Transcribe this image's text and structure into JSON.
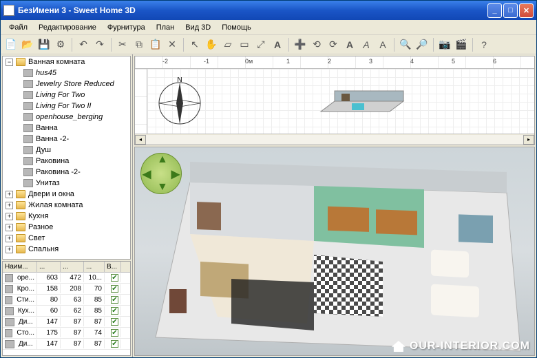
{
  "window": {
    "title": "БезИмени 3 - Sweet Home 3D"
  },
  "menu": [
    "Файл",
    "Редактирование",
    "Фурнитура",
    "План",
    "Вид 3D",
    "Помощь"
  ],
  "toolbar_icons": [
    "new-file",
    "open",
    "save",
    "preferences",
    "undo",
    "redo",
    "cut",
    "copy",
    "paste",
    "delete",
    "select",
    "pan",
    "walls",
    "room",
    "dimension",
    "text",
    "compass",
    "rotate-left",
    "rotate-right",
    "text-bold",
    "text-italic",
    "zoom-in",
    "zoom-out",
    "camera",
    "snapshot",
    "help"
  ],
  "tree": {
    "root": "Ванная комната",
    "children_italic": [
      "hus45",
      "Jewelry Store Reduced",
      "Living For Two",
      "Living For Two II",
      "openhouse_berging"
    ],
    "children_plain": [
      "Ванна",
      "Ванна -2-",
      "Душ",
      "Раковина",
      "Раковина -2-",
      "Унитаз"
    ],
    "siblings": [
      "Двери и окна",
      "Жилая комната",
      "Кухня",
      "Разное",
      "Свет",
      "Спальня"
    ]
  },
  "table": {
    "headers": [
      "Наим...",
      "...",
      "...",
      "...",
      "В..."
    ],
    "rows": [
      {
        "name": "оре...",
        "w": "603",
        "d": "472",
        "h": "10...",
        "v": true
      },
      {
        "name": "Кро...",
        "w": "158",
        "d": "208",
        "h": "70",
        "v": true
      },
      {
        "name": "Сти...",
        "w": "80",
        "d": "63",
        "h": "85",
        "v": true
      },
      {
        "name": "Кух...",
        "w": "60",
        "d": "62",
        "h": "85",
        "v": true
      },
      {
        "name": "Ди...",
        "w": "147",
        "d": "87",
        "h": "87",
        "v": true
      },
      {
        "name": "Сто...",
        "w": "175",
        "d": "87",
        "h": "74",
        "v": true
      },
      {
        "name": "Ди...",
        "w": "147",
        "d": "87",
        "h": "87",
        "v": true
      }
    ]
  },
  "ruler_marks": [
    "-2",
    "-1",
    "0м",
    "1",
    "2",
    "3",
    "4",
    "5",
    "6"
  ],
  "compass_label": "N",
  "watermark": "OUR-INTERIOR.COM"
}
